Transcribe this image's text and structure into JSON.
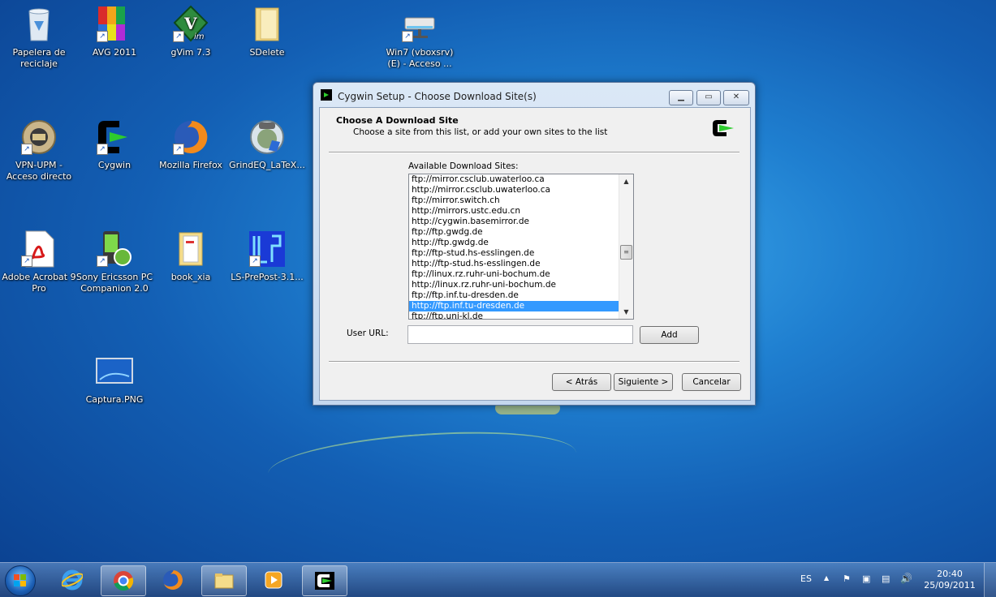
{
  "desktop_icons": [
    {
      "label": "Papelera de reciclaje"
    },
    {
      "label": "AVG 2011"
    },
    {
      "label": "gVim 7.3"
    },
    {
      "label": "SDelete"
    },
    {
      "label": "Win7 (vboxsrv) (E) - Acceso ..."
    },
    {
      "label": "VPN-UPM - Acceso directo"
    },
    {
      "label": "Cygwin"
    },
    {
      "label": "Mozilla Firefox"
    },
    {
      "label": "GrindEQ_LaTeX..."
    },
    {
      "label": "Adobe Acrobat 9 Pro"
    },
    {
      "label": "Sony Ericsson PC Companion 2.0"
    },
    {
      "label": "book_xia"
    },
    {
      "label": "LS-PrePost-3.1..."
    },
    {
      "label": "Captura.PNG"
    }
  ],
  "window": {
    "title": "Cygwin Setup - Choose Download Site(s)",
    "header_title": "Choose A Download Site",
    "header_subtitle": "Choose a site from this list, or add your own sites to the list",
    "list_label": "Available Download Sites:",
    "sites": [
      "ftp://mirror.csclub.uwaterloo.ca",
      "http://mirror.csclub.uwaterloo.ca",
      "ftp://mirror.switch.ch",
      "http://mirrors.ustc.edu.cn",
      "http://cygwin.basemirror.de",
      "ftp://ftp.gwdg.de",
      "http://ftp.gwdg.de",
      "ftp://ftp-stud.hs-esslingen.de",
      "http://ftp-stud.hs-esslingen.de",
      "ftp://linux.rz.ruhr-uni-bochum.de",
      "http://linux.rz.ruhr-uni-bochum.de",
      "ftp://ftp.inf.tu-dresden.de",
      "http://ftp.inf.tu-dresden.de",
      "ftp://ftp.uni-kl.de"
    ],
    "selected_site": "http://ftp.inf.tu-dresden.de",
    "user_url_label": "User URL:",
    "user_url_value": "",
    "add_label": "Add",
    "back_label": "< Atrás",
    "next_label": "Siguiente >",
    "cancel_label": "Cancelar"
  },
  "taskbar": {
    "apps": [
      "internet-explorer",
      "google-chrome",
      "firefox",
      "windows-explorer",
      "media-player",
      "cygwin-setup"
    ],
    "language": "ES",
    "time": "20:40",
    "date": "25/09/2011"
  }
}
